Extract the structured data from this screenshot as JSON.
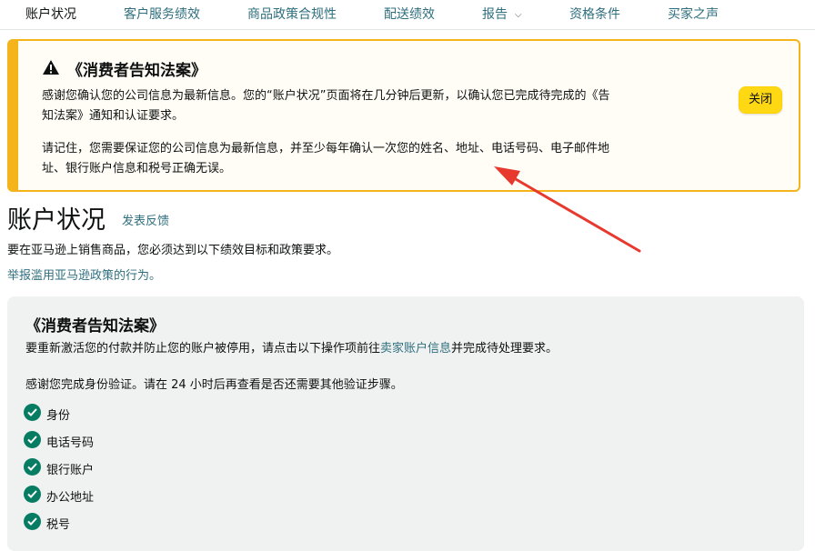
{
  "nav": {
    "tabs": [
      {
        "label": "账户状况"
      },
      {
        "label": "客户服务绩效"
      },
      {
        "label": "商品政策合规性"
      },
      {
        "label": "配送绩效"
      },
      {
        "label": "报告"
      },
      {
        "label": "资格条件"
      },
      {
        "label": "买家之声"
      }
    ]
  },
  "alert": {
    "icon": "warning-icon",
    "title": "《消费者告知法案》",
    "paragraph1_line1": "感谢您确认您的公司信息为最新信息。您的“账户状况”页面将在几分钟后更新，以确认您已完成待完成的《告",
    "paragraph1_line2": "知法案》通知和认证要求。",
    "paragraph2_line1": "请记住，您需要保证您的公司信息为最新信息，并至少每年确认一次您的姓名、地址、电话号码、电子邮件地",
    "paragraph2_line2": "址、银行账户信息和税号正确无误。",
    "close_label": "关闭",
    "close_color": "#ffd814",
    "border_color": "#f5b41c"
  },
  "annotation": {
    "arrow_color": "#e8392f"
  },
  "page": {
    "title": "账户状况",
    "feedback_link": "发表反馈",
    "intro": "要在亚马逊上销售商品，您必须达到以下绩效目标和政策要求。",
    "report_link": "举报滥用亚马逊政策的行为。"
  },
  "panel": {
    "title": "《消费者告知法案》",
    "desc_before": "要重新激活您的付款并防止您的账户被停用，请点击以下操作项前往",
    "desc_link": "卖家账户信息",
    "desc_after": "并完成待处理要求。",
    "thanks": "感谢您完成身份验证。请在 24 小时后再查看是否还需要其他验证步骤。",
    "checks": [
      {
        "label": "身份",
        "icon": "check-circle-icon"
      },
      {
        "label": "电话号码",
        "icon": "check-circle-icon"
      },
      {
        "label": "银行账户",
        "icon": "check-circle-icon"
      },
      {
        "label": "办公地址",
        "icon": "check-circle-icon"
      },
      {
        "label": "税号",
        "icon": "check-circle-icon"
      }
    ],
    "check_color": "#067d62"
  }
}
